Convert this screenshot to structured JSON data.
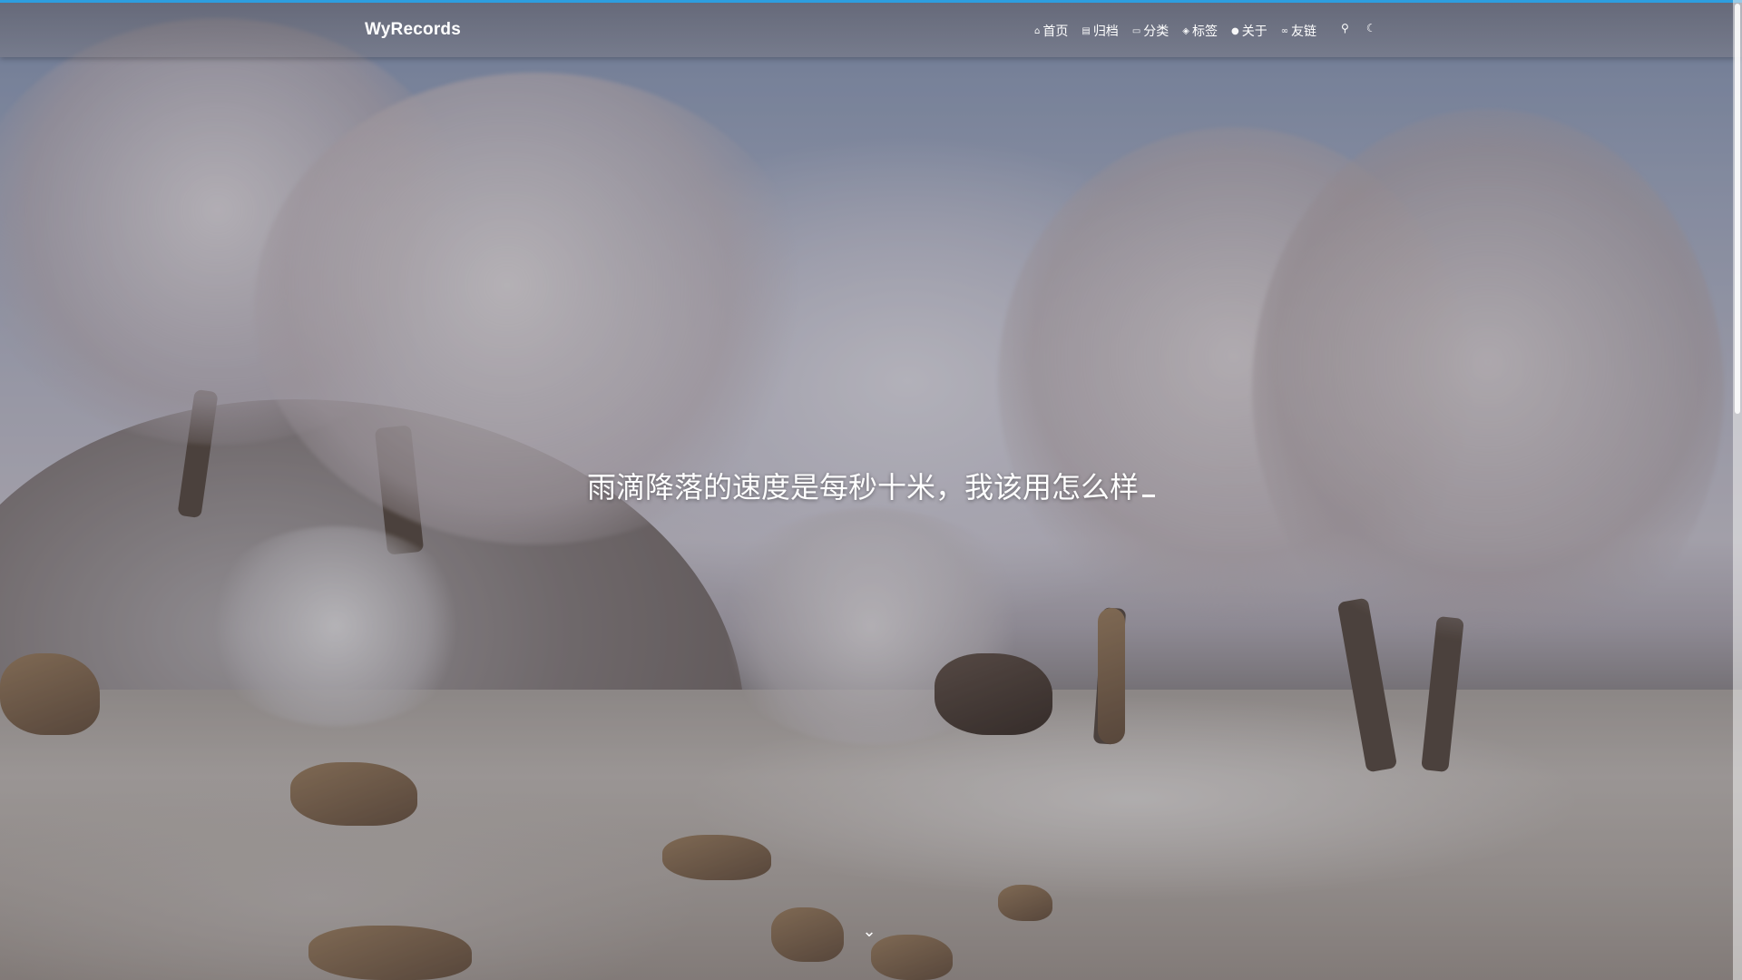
{
  "brand": {
    "name": "WyRecords"
  },
  "nav": {
    "items": [
      {
        "icon": "home-icon",
        "label": "首页"
      },
      {
        "icon": "archive-icon",
        "label": "归档"
      },
      {
        "icon": "folder-icon",
        "label": "分类"
      },
      {
        "icon": "tag-icon",
        "label": "标签"
      },
      {
        "icon": "user-icon",
        "label": "关于"
      },
      {
        "icon": "link-icon",
        "label": "友链"
      }
    ],
    "tools": [
      "search-icon",
      "moon-icon"
    ]
  },
  "hero": {
    "subtitle": "雨滴降落的速度是每秒十米，我该用怎么样"
  },
  "colors": {
    "accent": "#2d9ee0",
    "text": "#ffffff"
  }
}
